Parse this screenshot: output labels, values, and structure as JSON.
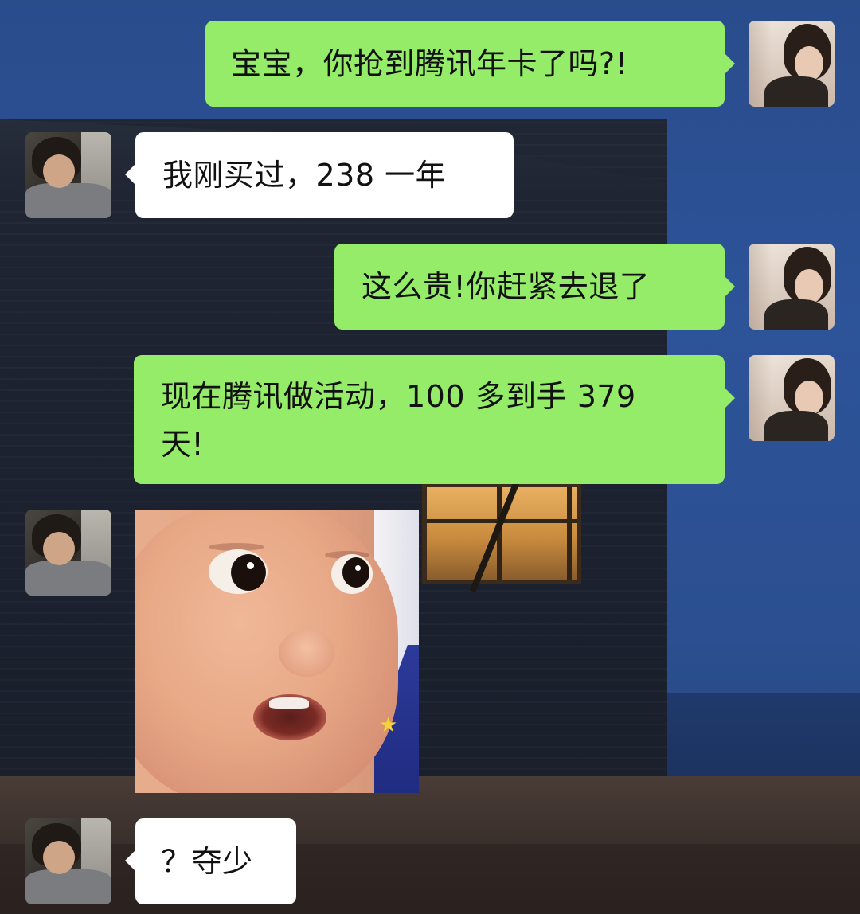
{
  "chat": {
    "messages": [
      {
        "id": 1,
        "side": "outgoing",
        "type": "text",
        "lines": [
          "宝宝，你抢到腾讯年卡了吗?!"
        ]
      },
      {
        "id": 2,
        "side": "incoming",
        "type": "text",
        "lines": [
          "我刚买过，238 一年"
        ]
      },
      {
        "id": 3,
        "side": "outgoing",
        "type": "text",
        "lines": [
          "这么贵!你赶紧去退了"
        ]
      },
      {
        "id": 4,
        "side": "outgoing",
        "type": "text",
        "lines": [
          "现在腾讯做活动，100 多到手 379",
          "天!"
        ]
      },
      {
        "id": 5,
        "side": "incoming",
        "type": "sticker",
        "sticker": "surprised-baby-face"
      },
      {
        "id": 6,
        "side": "incoming",
        "type": "text",
        "lines": [
          "？夺少"
        ]
      }
    ],
    "colors": {
      "outgoing_bubble": "#95ec69",
      "incoming_bubble": "#ffffff",
      "text": "#111111"
    }
  }
}
